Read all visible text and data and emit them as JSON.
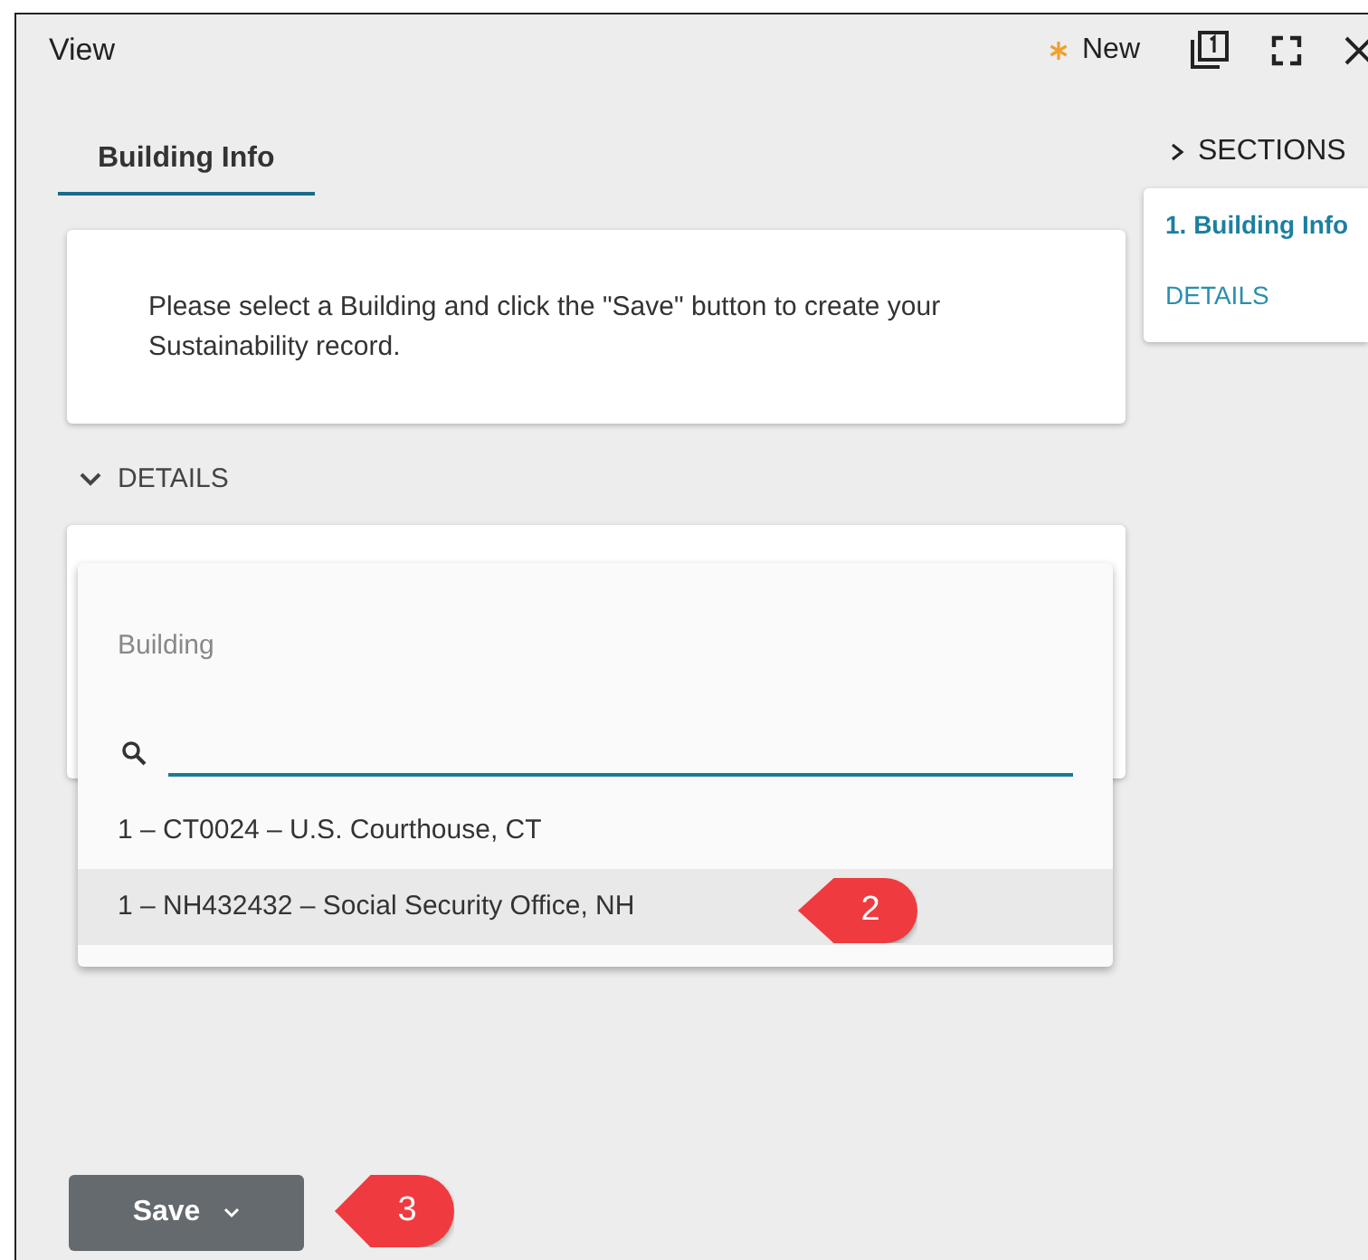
{
  "window": {
    "title": "View",
    "status": "New"
  },
  "tabs": [
    {
      "label": "Building Info",
      "selected": true
    }
  ],
  "sections_panel": {
    "heading": "SECTIONS",
    "items": [
      {
        "label": "1. Building Info",
        "selected": true
      },
      {
        "label": "DETAILS",
        "selected": false
      }
    ]
  },
  "notice": "Please select a Building and click the \"Save\" button to create your Sustainability record.",
  "details": {
    "heading": "DETAILS",
    "expanded": true
  },
  "building_dropdown": {
    "label": "Building",
    "options": [
      {
        "label": "1 – CT0024 – U.S. Courthouse, CT",
        "selected": false
      },
      {
        "label": "1 – NH432432 – Social Security Office, NH",
        "selected": true
      }
    ]
  },
  "save_button": {
    "label": "Save"
  },
  "callouts": [
    "2",
    "3"
  ]
}
